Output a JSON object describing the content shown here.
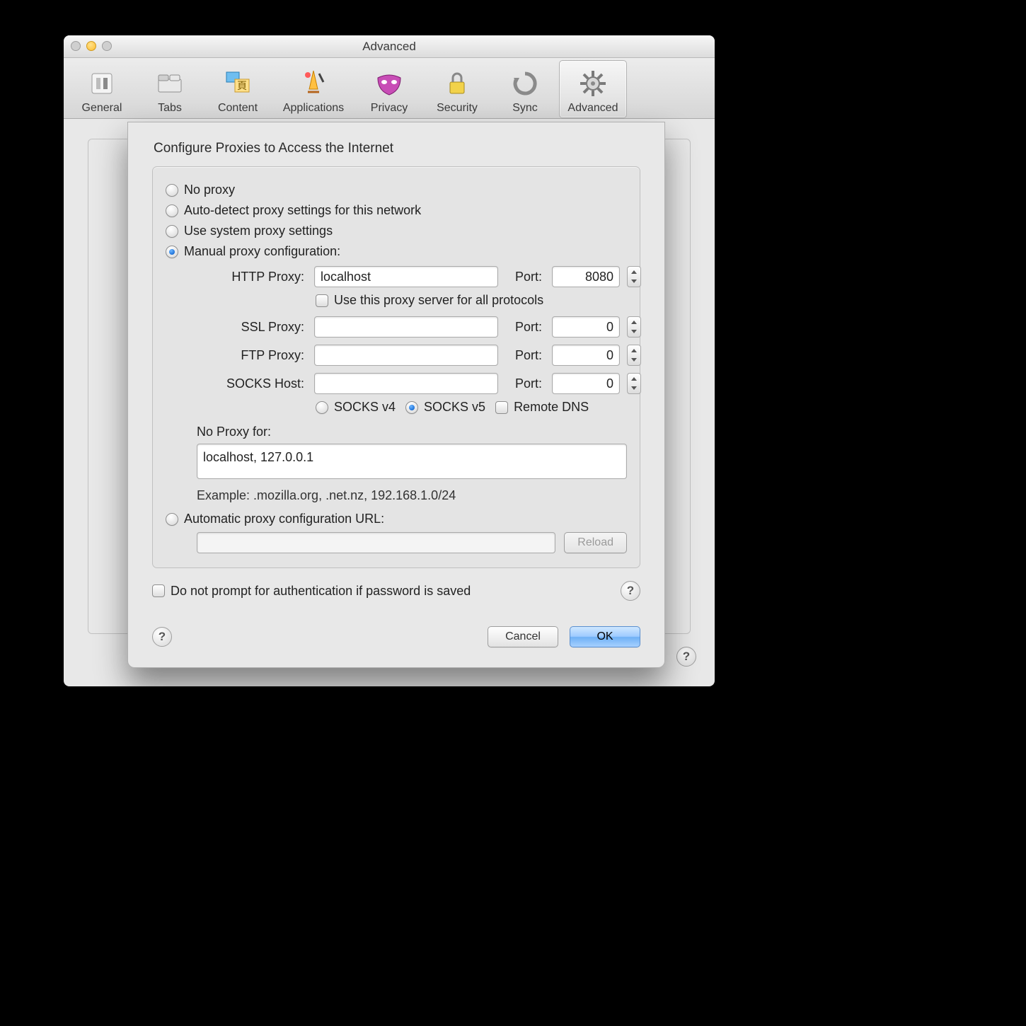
{
  "window": {
    "title": "Advanced"
  },
  "toolbar": {
    "items": [
      {
        "id": "general",
        "label": "General"
      },
      {
        "id": "tabs",
        "label": "Tabs"
      },
      {
        "id": "content",
        "label": "Content"
      },
      {
        "id": "applications",
        "label": "Applications"
      },
      {
        "id": "privacy",
        "label": "Privacy"
      },
      {
        "id": "security",
        "label": "Security"
      },
      {
        "id": "sync",
        "label": "Sync"
      },
      {
        "id": "advanced",
        "label": "Advanced"
      }
    ],
    "selected": "advanced"
  },
  "sheet": {
    "title": "Configure Proxies to Access the Internet",
    "mode": {
      "no_proxy": "No proxy",
      "auto_detect": "Auto-detect proxy settings for this network",
      "system": "Use system proxy settings",
      "manual": "Manual proxy configuration:",
      "pac": "Automatic proxy configuration URL:",
      "selected": "manual"
    },
    "labels": {
      "http": "HTTP Proxy:",
      "ssl": "SSL Proxy:",
      "ftp": "FTP Proxy:",
      "socks": "SOCKS Host:",
      "port": "Port:",
      "use_for_all": "Use this proxy server for all protocols",
      "no_proxy_for": "No Proxy for:",
      "example": "Example: .mozilla.org, .net.nz, 192.168.1.0/24",
      "socks_v4": "SOCKS v4",
      "socks_v5": "SOCKS v5",
      "remote_dns": "Remote DNS",
      "reload": "Reload",
      "no_prompt": "Do not prompt for authentication if password is saved",
      "cancel": "Cancel",
      "ok": "OK"
    },
    "values": {
      "http_host": "localhost",
      "http_port": "8080",
      "ssl_host": "",
      "ssl_port": "0",
      "ftp_host": "",
      "ftp_port": "0",
      "socks_host": "",
      "socks_port": "0",
      "use_for_all": false,
      "socks_version": "v5",
      "remote_dns": false,
      "no_proxy_for": "localhost, 127.0.0.1",
      "pac_url": "",
      "no_prompt": false
    }
  }
}
